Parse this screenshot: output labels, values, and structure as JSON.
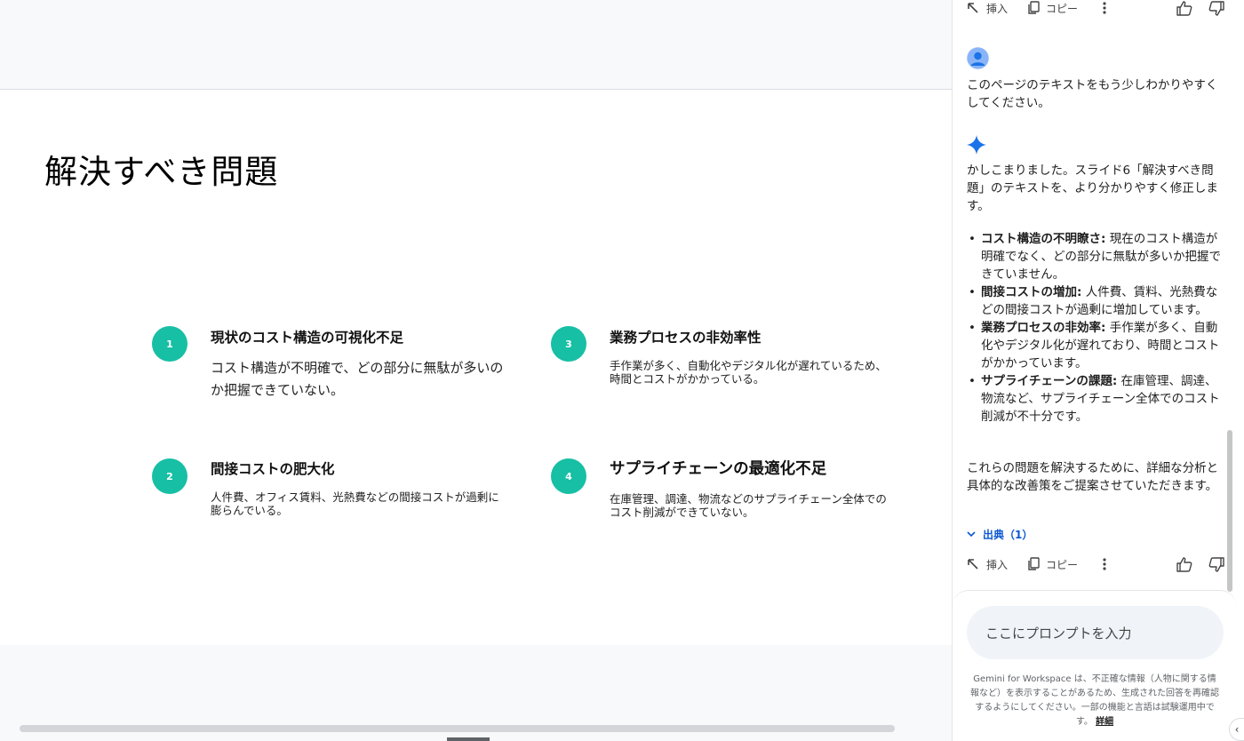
{
  "slide": {
    "title": "解決すべき問題",
    "items": [
      {
        "number": "1",
        "title": "現状のコスト構造の可視化不足",
        "description": "コスト構造が不明確で、どの部分に無駄が多いのか把握できていない。"
      },
      {
        "number": "2",
        "title": "間接コストの肥大化",
        "description": "人件費、オフィス賃料、光熱費などの間接コストが過剰に膨らんでいる。"
      },
      {
        "number": "3",
        "title": "業務プロセスの非効率性",
        "description": "手作業が多く、自動化やデジタル化が遅れているため、時間とコストがかかっている。"
      },
      {
        "number": "4",
        "title": "サプライチェーンの最適化不足",
        "description": "在庫管理、調達、物流などのサプライチェーン全体でのコスト削減ができていない。"
      }
    ]
  },
  "actions": {
    "insert_label": "挿入",
    "copy_label": "コピー"
  },
  "chat": {
    "user_message": "このページのテキストをもう少しわかりやすくしてください。",
    "response_intro": "かしこまりました。スライド6「解決すべき問題」のテキストを、より分かりやすく修正します。",
    "bullets": [
      {
        "bold": "コスト構造の不明瞭さ:",
        "text": " 現在のコスト構造が明確でなく、どの部分に無駄が多いか把握できていません。"
      },
      {
        "bold": "間接コストの増加:",
        "text": " 人件費、賃料、光熱費などの間接コストが過剰に増加しています。"
      },
      {
        "bold": "業務プロセスの非効率:",
        "text": " 手作業が多く、自動化やデジタル化が遅れており、時間とコストがかかっています。"
      },
      {
        "bold": "サプライチェーンの課題:",
        "text": " 在庫管理、調達、物流など、サプライチェーン全体でのコスト削減が不十分です。"
      }
    ],
    "response_outro": "これらの問題を解決するために、詳細な分析と具体的な改善策をご提案させていただきます。",
    "sources_label": "出典（1）"
  },
  "prompt": {
    "placeholder": "ここにプロンプトを入力",
    "disclaimer": "Gemini for Workspace は、不正確な情報（人物に関する情報など）を表示することがあるため、生成された回答を再確認するようにしてください。一部の機能と言語は試験運用中です。",
    "details_link": "詳細"
  },
  "colors": {
    "accent_teal": "#17bfa5",
    "gemini_blue": "#1a73e8",
    "link_blue": "#0b57d0"
  }
}
